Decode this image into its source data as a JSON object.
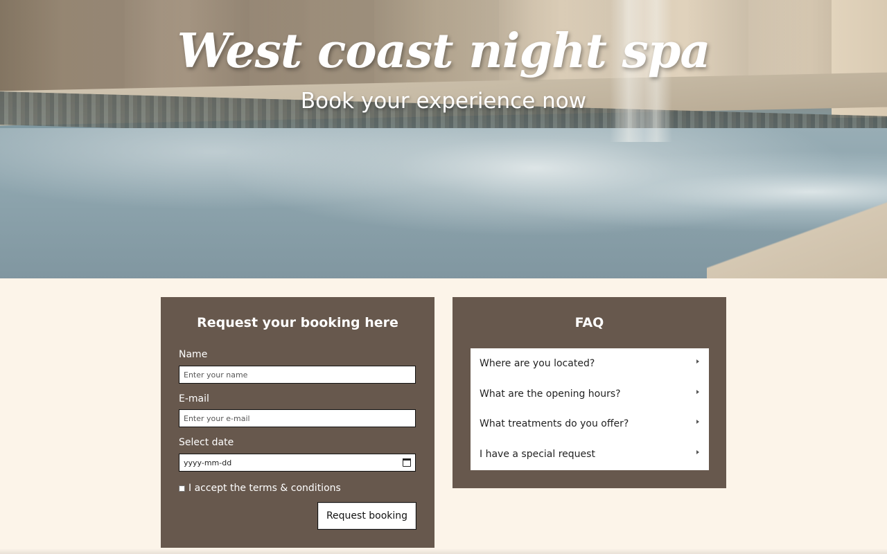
{
  "hero": {
    "title": "West coast night spa",
    "subtitle": "Book your experience now"
  },
  "booking": {
    "title": "Request your booking here",
    "name_label": "Name",
    "name_placeholder": "Enter your name",
    "email_label": "E-mail",
    "email_placeholder": "Enter your e-mail",
    "date_label": "Select date",
    "date_placeholder": "yyyy-mm-dd",
    "terms_label": "I accept the terms & conditions",
    "terms_checked": false,
    "submit_label": "Request booking"
  },
  "faq": {
    "title": "FAQ",
    "items": [
      {
        "question": "Where are you located?"
      },
      {
        "question": "What are the opening hours?"
      },
      {
        "question": "What treatments do you offer?"
      },
      {
        "question": "I have a special request"
      }
    ]
  },
  "colors": {
    "page_background": "#fcf4e9",
    "panel_background": "#67584d"
  },
  "icons": {
    "calendar": "calendar-icon",
    "faq_expand": "caret-right-icon"
  }
}
